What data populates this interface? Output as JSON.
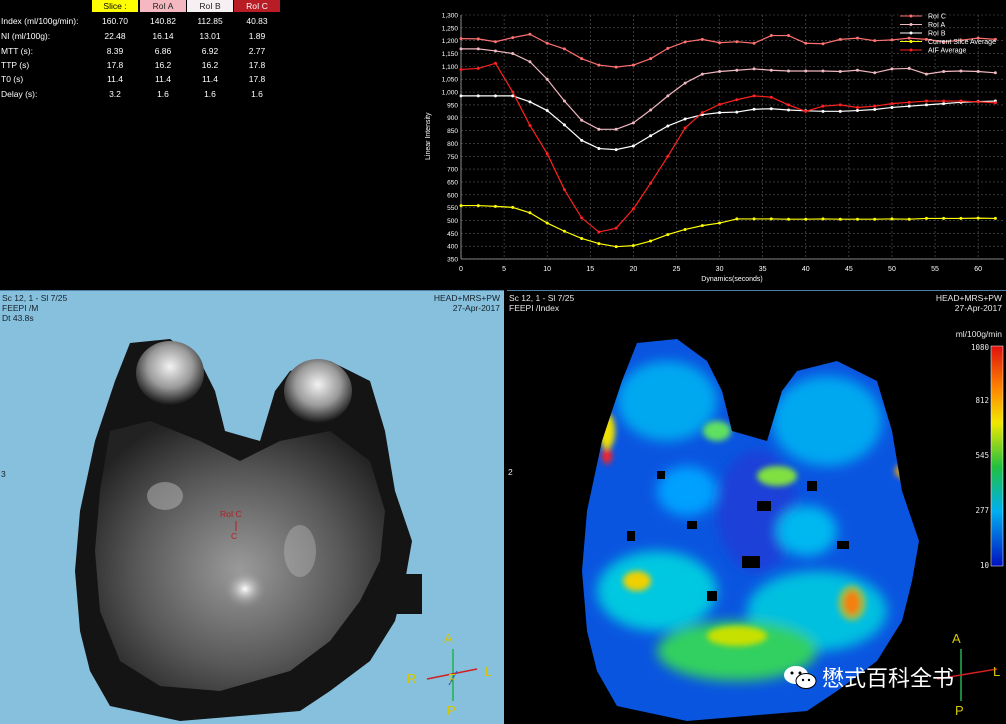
{
  "stats": {
    "headers": [
      {
        "label": "Slice :",
        "color": "#ffff00"
      },
      {
        "label": "RoI A",
        "color": "#f5b8c0"
      },
      {
        "label": "RoI B",
        "color": "#f6f0f2"
      },
      {
        "label": "RoI C",
        "color": "#b81c24"
      }
    ],
    "rows": [
      {
        "label": "Index  (ml/100g/min):",
        "values": [
          "160.70",
          "140.82",
          "112.85",
          "40.83"
        ]
      },
      {
        "label": "NI  (ml/100g):",
        "values": [
          "22.48",
          "16.14",
          "13.01",
          "1.89"
        ]
      },
      {
        "label": "MTT  (s):",
        "values": [
          "8.39",
          "6.86",
          "6.92",
          "2.77"
        ]
      },
      {
        "label": "TTP  (s)",
        "values": [
          "17.8",
          "16.2",
          "16.2",
          "17.8"
        ]
      },
      {
        "label": "T0  (s)",
        "values": [
          "11.4",
          "11.4",
          "11.4",
          "17.8"
        ]
      },
      {
        "label": "Delay  (s):",
        "values": [
          "3.2",
          "1.6",
          "1.6",
          "1.6"
        ]
      }
    ]
  },
  "chart_data": {
    "type": "line",
    "xlabel": "Dynamics(seconds)",
    "ylabel": "Linear Intensity",
    "xlim": [
      0,
      63
    ],
    "ylim": [
      350,
      1300
    ],
    "xticks": [
      0,
      5,
      10,
      15,
      20,
      25,
      30,
      35,
      40,
      45,
      50,
      55,
      60
    ],
    "yticks": [
      350,
      400,
      450,
      500,
      550,
      600,
      650,
      700,
      750,
      800,
      850,
      900,
      950,
      1000,
      1050,
      1100,
      1150,
      1200,
      1250,
      1300
    ],
    "legend_position": "top-right",
    "series": [
      {
        "name": "RoI C",
        "color": "#ff7070",
        "x": [
          0,
          2,
          4,
          6,
          8,
          10,
          12,
          14,
          16,
          18,
          20,
          22,
          24,
          26,
          28,
          30,
          32,
          34,
          36,
          38,
          40,
          42,
          44,
          46,
          48,
          50,
          52,
          54,
          56,
          58,
          60,
          62
        ],
        "y": [
          1208,
          1207,
          1196,
          1212,
          1225,
          1190,
          1168,
          1130,
          1105,
          1097,
          1105,
          1130,
          1170,
          1195,
          1205,
          1192,
          1196,
          1190,
          1220,
          1220,
          1190,
          1188,
          1205,
          1210,
          1200,
          1203,
          1210,
          1205,
          1195,
          1202,
          1210,
          1205
        ]
      },
      {
        "name": "RoI A",
        "color": "#f0b8c0",
        "x": [
          0,
          2,
          4,
          6,
          8,
          10,
          12,
          14,
          16,
          18,
          20,
          22,
          24,
          26,
          28,
          30,
          32,
          34,
          36,
          38,
          40,
          42,
          44,
          46,
          48,
          50,
          52,
          54,
          56,
          58,
          60,
          62
        ],
        "y": [
          1168,
          1168,
          1160,
          1150,
          1118,
          1050,
          965,
          890,
          855,
          855,
          880,
          930,
          985,
          1035,
          1070,
          1080,
          1085,
          1090,
          1085,
          1082,
          1082,
          1082,
          1080,
          1085,
          1075,
          1090,
          1092,
          1070,
          1080,
          1082,
          1080,
          1075
        ]
      },
      {
        "name": "RoI B",
        "color": "#ffffff",
        "x": [
          0,
          2,
          4,
          6,
          8,
          10,
          12,
          14,
          16,
          18,
          20,
          22,
          24,
          26,
          28,
          30,
          32,
          34,
          36,
          38,
          40,
          42,
          44,
          46,
          48,
          50,
          52,
          54,
          56,
          58,
          60,
          62
        ],
        "y": [
          985,
          985,
          985,
          985,
          962,
          928,
          872,
          812,
          780,
          776,
          790,
          830,
          868,
          895,
          912,
          920,
          922,
          933,
          935,
          930,
          927,
          925,
          925,
          928,
          932,
          940,
          945,
          950,
          955,
          960,
          963,
          965
        ]
      },
      {
        "name": "Current Slice Average",
        "color": "#ffff00",
        "x": [
          0,
          2,
          4,
          6,
          8,
          10,
          12,
          14,
          16,
          18,
          20,
          22,
          24,
          26,
          28,
          30,
          32,
          34,
          36,
          38,
          40,
          42,
          44,
          46,
          48,
          50,
          52,
          54,
          56,
          58,
          60,
          62
        ],
        "y": [
          558,
          558,
          555,
          551,
          530,
          490,
          458,
          430,
          410,
          398,
          402,
          420,
          445,
          465,
          480,
          490,
          506,
          506,
          506,
          505,
          505,
          506,
          505,
          505,
          505,
          506,
          505,
          508,
          508,
          508,
          509,
          508
        ]
      },
      {
        "name": "AIF Average",
        "color": "#ff2020",
        "x": [
          0,
          2,
          4,
          6,
          8,
          10,
          12,
          14,
          16,
          18,
          20,
          22,
          24,
          26,
          28,
          30,
          32,
          34,
          36,
          38,
          40,
          42,
          44,
          46,
          48,
          50,
          52,
          54,
          56,
          58,
          60,
          62
        ],
        "y": [
          1088,
          1092,
          1112,
          1000,
          870,
          760,
          620,
          510,
          455,
          470,
          545,
          645,
          750,
          860,
          920,
          952,
          970,
          985,
          980,
          950,
          925,
          945,
          950,
          940,
          945,
          955,
          960,
          965,
          965,
          965,
          962,
          958
        ]
      }
    ]
  },
  "viewer_left": {
    "top_left": [
      "Sc 12, 1 - Sl 7/25",
      "FEEPI  /M",
      "Dt 43.8s"
    ],
    "top_right": [
      "HEAD+MRS+PW",
      "27-Apr-2017"
    ],
    "roi_label": "RoI C",
    "roi_mark": "C",
    "side_marker": "3",
    "orientation": {
      "top": "A",
      "bottom": "P",
      "left": "R",
      "right": "L",
      "center": "F"
    }
  },
  "viewer_right": {
    "top_left": [
      "Sc 12, 1 - Sl 7/25",
      "FEEPI  /Index"
    ],
    "top_right": [
      "HEAD+MRS+PW",
      "27-Apr-2017"
    ],
    "colorbar_title": "ml/100g/min",
    "colorbar_ticks": [
      "1080",
      "812",
      "545",
      "277",
      "10"
    ],
    "side_marker": "2",
    "orientation": {
      "top": "A",
      "bottom": "P",
      "right": "L"
    },
    "watermark": "懋式百科全书"
  }
}
